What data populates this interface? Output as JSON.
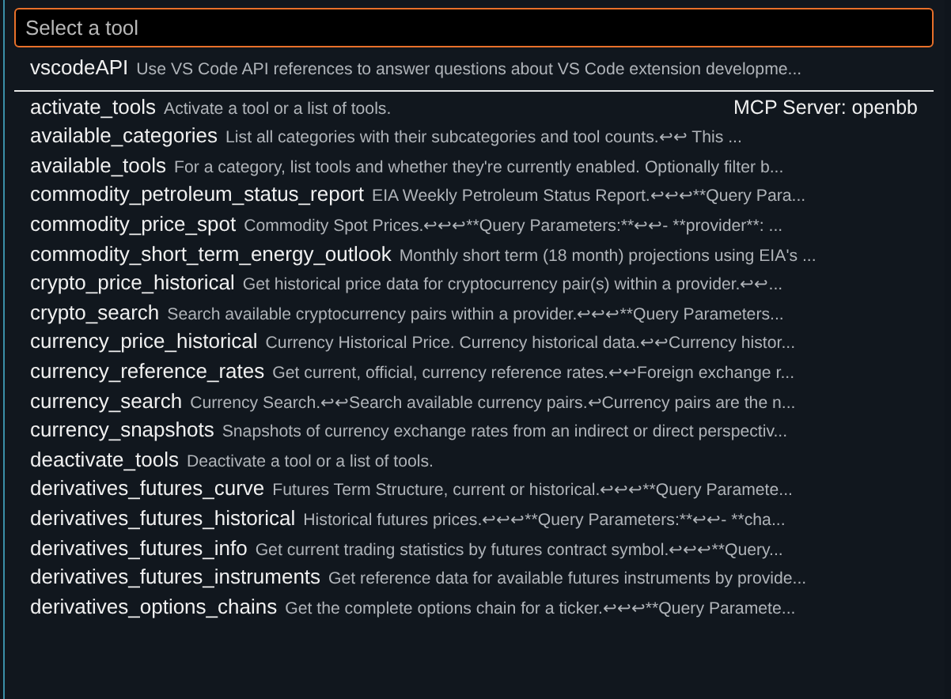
{
  "search": {
    "placeholder": "Select a tool"
  },
  "pinned": {
    "name": "vscodeAPI",
    "description": "Use VS Code API references to answer questions about VS Code extension developme..."
  },
  "group_label": "MCP Server: openbb",
  "tools": [
    {
      "name": "activate_tools",
      "description": "Activate a tool or a list of tools."
    },
    {
      "name": "available_categories",
      "description": "List all categories with their subcategories and tool counts.↩↩               This ..."
    },
    {
      "name": "available_tools",
      "description": "For a category, list tools and whether they're currently enabled. Optionally filter b..."
    },
    {
      "name": "commodity_petroleum_status_report",
      "description": "EIA Weekly Petroleum Status Report.↩↩↩**Query Para..."
    },
    {
      "name": "commodity_price_spot",
      "description": "Commodity Spot Prices.↩↩↩**Query Parameters:**↩↩- **provider**: ..."
    },
    {
      "name": "commodity_short_term_energy_outlook",
      "description": "Monthly short term (18 month) projections using EIA's ..."
    },
    {
      "name": "crypto_price_historical",
      "description": "Get historical price data for cryptocurrency pair(s) within a provider.↩↩..."
    },
    {
      "name": "crypto_search",
      "description": "Search available cryptocurrency pairs within a provider.↩↩↩**Query Parameters..."
    },
    {
      "name": "currency_price_historical",
      "description": "Currency Historical Price. Currency historical data.↩↩Currency histor..."
    },
    {
      "name": "currency_reference_rates",
      "description": "Get current, official, currency reference rates.↩↩Foreign exchange r..."
    },
    {
      "name": "currency_search",
      "description": "Currency Search.↩↩Search available currency pairs.↩Currency pairs are the n..."
    },
    {
      "name": "currency_snapshots",
      "description": "Snapshots of currency exchange rates from an indirect or direct perspectiv..."
    },
    {
      "name": "deactivate_tools",
      "description": "Deactivate a tool or a list of tools."
    },
    {
      "name": "derivatives_futures_curve",
      "description": "Futures Term Structure, current or historical.↩↩↩**Query Paramete..."
    },
    {
      "name": "derivatives_futures_historical",
      "description": "Historical futures prices.↩↩↩**Query Parameters:**↩↩- **cha..."
    },
    {
      "name": "derivatives_futures_info",
      "description": "Get current trading statistics by futures contract symbol.↩↩↩**Query..."
    },
    {
      "name": "derivatives_futures_instruments",
      "description": "Get reference data for available futures instruments by provide..."
    },
    {
      "name": "derivatives_options_chains",
      "description": "Get the complete options chain for a ticker.↩↩↩**Query Paramete..."
    }
  ]
}
